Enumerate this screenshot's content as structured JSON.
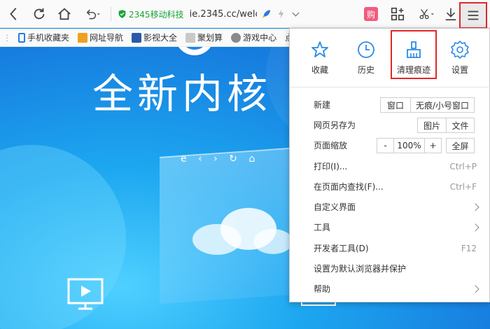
{
  "toolbar": {
    "site_name": "2345移动科技",
    "url": "ie.2345.cc/welc",
    "gou_badge": "购",
    "icons": [
      "back-icon",
      "refresh-icon",
      "home-icon",
      "undo-icon",
      "shield-icon",
      "rocket-icon",
      "lightning-icon",
      "chevron-down-icon",
      "shopping-icon",
      "apps-icon",
      "scissors-icon",
      "download-icon",
      "menu-icon"
    ],
    "accent": "#e0282a",
    "site_color": "#1aa33a"
  },
  "bookmarks": [
    {
      "label": "手机收藏夹",
      "color": "#2b7be0"
    },
    {
      "label": "网址导航",
      "color": "#f0a020"
    },
    {
      "label": "影视大全",
      "color": "#2a5aa8"
    },
    {
      "label": "聚划算",
      "color": "#c9c9c9"
    },
    {
      "label": "游戏中心",
      "color": "#8a8a8a"
    },
    {
      "label": "点此",
      "color": "#999999"
    }
  ],
  "content": {
    "headline": "全新内核"
  },
  "menu": {
    "quick": [
      {
        "label": "收藏",
        "icon": "star-icon"
      },
      {
        "label": "历史",
        "icon": "clock-icon"
      },
      {
        "label": "清理痕迹",
        "icon": "broom-icon",
        "highlighted": true
      },
      {
        "label": "设置",
        "icon": "gear-icon"
      }
    ],
    "new": {
      "label": "新建",
      "window": "窗口",
      "private": "无痕/小号窗口"
    },
    "save_as": {
      "label": "网页另存为",
      "image": "图片",
      "file": "文件"
    },
    "zoom": {
      "label": "页面缩放",
      "minus": "-",
      "value": "100%",
      "plus": "+",
      "fullscreen": "全屏"
    },
    "print": {
      "label": "打印(I)...",
      "shortcut": "Ctrl+P"
    },
    "find": {
      "label": "在页面内查找(F)...",
      "shortcut": "Ctrl+F"
    },
    "customize": {
      "label": "自定义界面"
    },
    "tools": {
      "label": "工具"
    },
    "devtools": {
      "label": "开发者工具(D)",
      "shortcut": "F12"
    },
    "default_browser": {
      "label": "设置为默认浏览器并保护"
    },
    "help": {
      "label": "帮助"
    }
  }
}
